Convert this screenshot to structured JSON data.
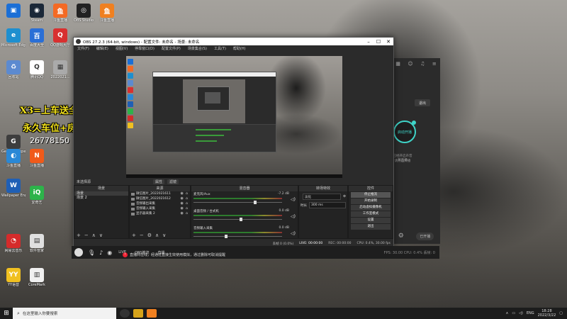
{
  "desktop": {
    "icons": [
      {
        "label": "",
        "color": "#1b6fd6",
        "glyph": "▣"
      },
      {
        "label": "Steam",
        "color": "#1b2838",
        "glyph": "◉"
      },
      {
        "label": "斗鱼直播",
        "color": "#f46a24",
        "glyph": "鱼"
      },
      {
        "label": "OBS Studio",
        "color": "#222222",
        "glyph": "◎"
      },
      {
        "label": "斗鱼直播",
        "color": "#f08020",
        "glyph": "鱼"
      },
      {
        "label": "Microsoft Edge",
        "color": "#1e8fcf",
        "glyph": "e"
      },
      {
        "label": "百度大全",
        "color": "#2a6fd6",
        "glyph": "百"
      },
      {
        "label": "QQ游戏大厅",
        "color": "#d83030",
        "glyph": "Q"
      },
      {
        "label": "回收站",
        "color": "#5c8ad0",
        "glyph": "♻"
      },
      {
        "label": "腾讯QQ",
        "color": "#ffffff",
        "glyph": "Q"
      },
      {
        "label": "2022021...",
        "color": "#aaaaaa",
        "glyph": "▦"
      },
      {
        "label": "GeForce Experience",
        "color": "#3d3d3d",
        "glyph": "G"
      },
      {
        "label": "斗鱼直播",
        "color": "#f05a1a",
        "glyph": "N"
      },
      {
        "label": "斗鱼直播",
        "color": "#2a88d6",
        "glyph": "◐"
      },
      {
        "label": "Wallpaper Engine",
        "color": "#1f5fb5",
        "glyph": "W"
      },
      {
        "label": "爱奇艺",
        "color": "#2db34a",
        "glyph": "iQ"
      },
      {
        "label": "网易云音乐",
        "color": "#d52b2b",
        "glyph": "◔"
      },
      {
        "label": "软件管家",
        "color": "#e0e0e0",
        "glyph": "▤"
      },
      {
        "label": "YY语音",
        "color": "#f0c020",
        "glyph": "YY"
      },
      {
        "label": "CoreMark",
        "color": "#f0f0f0",
        "glyph": "▥"
      }
    ],
    "overlay_line1": "X3=上车送全装",
    "overlay_line2": "永久车位+房管",
    "overlay_number": "26778150"
  },
  "obs": {
    "title": "OBS 27.2.3 (64-bit, windows) - 配置文件: 未命名 - 场景: 未命名",
    "menu": [
      "文件(F)",
      "编辑(E)",
      "视图(V)",
      "停靠窗口(D)",
      "配置文件(P)",
      "场景集合(S)",
      "工具(T)",
      "帮助(H)"
    ],
    "scene_bar_label": "未选择源",
    "props_btn": "属性",
    "filters_btn": "滤镜",
    "docks": {
      "scenes": {
        "title": "场景",
        "items": [
          "场景",
          "场景 2"
        ]
      },
      "sources": {
        "title": "来源",
        "items": [
          "微信图片_2022021611",
          "微信图片_2022021612",
          "音频输出采集",
          "音频输入采集",
          "显示器采集 2"
        ]
      },
      "mixer": {
        "title": "混音器",
        "channels": [
          {
            "name": "麦克风/Aux",
            "db": "-7.2 dB",
            "level": 0.68
          },
          {
            "name": "桌面音频 / 台式机",
            "db": "0.0 dB",
            "level": 0.52
          },
          {
            "name": "音频输入采集",
            "db": "0.0 dB",
            "level": 0.35
          }
        ]
      },
      "transitions": {
        "title": "转场特效",
        "type_value": "淡化",
        "duration_label": "时长",
        "duration_value": "300 ms"
      },
      "controls": {
        "title": "控件",
        "buttons": [
          "停止推流",
          "开始录制",
          "启动虚拟摄像机",
          "工作室模式",
          "设置",
          "退出"
        ]
      }
    },
    "status": {
      "dropped": "丢帧 0 (0.0%)",
      "live": "LIVE: 00:00:00",
      "rec": "REC: 00:00:00",
      "cpu": "CPU: 0.4%, 30.00 fps"
    }
  },
  "side_panel": {
    "top_btn": "退出",
    "circle_text": "启动开播",
    "text_a": "已经开启声音和直播",
    "text_b": "请点击开播",
    "pill": "已开播"
  },
  "live_bar": {
    "labels": [
      "LIVE",
      "OBS推流",
      "直播"
    ],
    "message": "直播间在线，经通过直接生效使用模拟，通过删除可取消提醒",
    "fps": "FPS: 30.00  CPU: 0.4%  丢帧: 0"
  },
  "taskbar": {
    "search_placeholder": "在这里输入你要搜索",
    "lang": "ENG",
    "time": "18:28",
    "date": "2022/3/22"
  },
  "colors": {
    "accent": "#3fd4c8",
    "overlay_text": "#f2e11b",
    "obs_bg": "#2b2b2b"
  }
}
